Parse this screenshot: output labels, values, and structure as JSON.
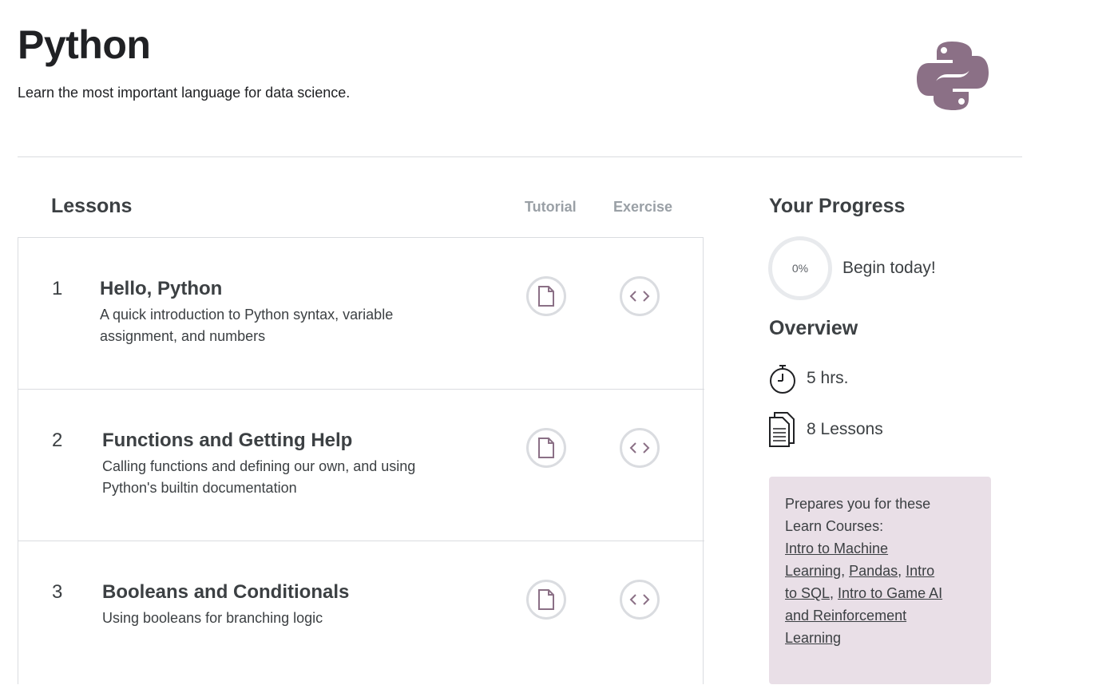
{
  "header": {
    "title": "Python",
    "subtitle": "Learn the most important language for data science.",
    "logo_icon": "python-logo-icon",
    "logo_color": "#8b7086"
  },
  "lessons_section": {
    "heading": "Lessons",
    "col_tutorial": "Tutorial",
    "col_exercise": "Exercise",
    "items": [
      {
        "number": "1",
        "title": "Hello, Python",
        "description": "A quick introduction to Python syntax, variable assignment, and numbers",
        "tutorial_icon": "document-icon",
        "exercise_icon": "code-icon"
      },
      {
        "number": "2",
        "title": "Functions and Getting Help",
        "description": "Calling functions and defining our own, and using Python's builtin documentation",
        "tutorial_icon": "document-icon",
        "exercise_icon": "code-icon"
      },
      {
        "number": "3",
        "title": "Booleans and Conditionals",
        "description": "Using booleans for branching logic",
        "tutorial_icon": "document-icon",
        "exercise_icon": "code-icon"
      }
    ]
  },
  "progress": {
    "heading": "Your Progress",
    "percent": "0%",
    "status": "Begin today!"
  },
  "overview": {
    "heading": "Overview",
    "duration": "5 hrs.",
    "duration_icon": "stopwatch-icon",
    "lessons_count": "8 Lessons",
    "lessons_icon": "document-stack-icon"
  },
  "prepares": {
    "intro": "Prepares you for these Learn Courses:",
    "courses": [
      "Intro to Machine Learning",
      "Pandas",
      "Intro to SQL",
      "Intro to Game AI and Reinforcement Learning"
    ],
    "background": "#e9dfe7"
  }
}
